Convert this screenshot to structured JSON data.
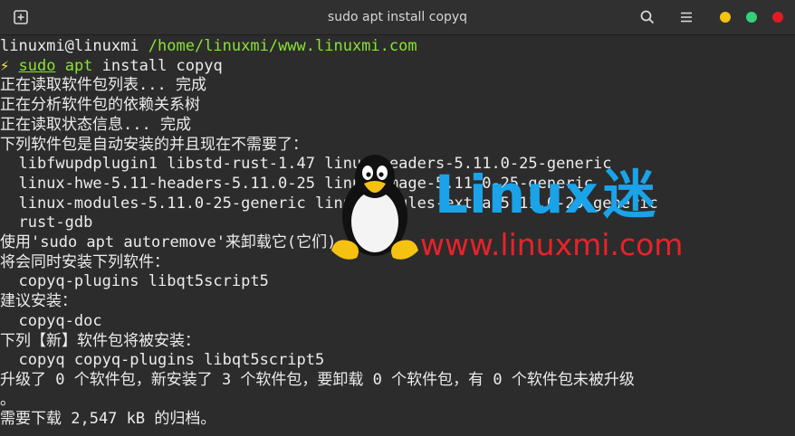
{
  "window": {
    "title": "sudo apt install copyq"
  },
  "prompt": {
    "user_host": "linuxmi@linuxmi",
    "path": "/home/linuxmi/www.linuxmi.com",
    "symbol": "⚡",
    "cmd_sudo": "sudo",
    "cmd_apt": "apt",
    "cmd_rest": " install copyq"
  },
  "output": [
    "正在读取软件包列表... 完成",
    "正在分析软件包的依赖关系树",
    "正在读取状态信息... 完成",
    "下列软件包是自动安装的并且现在不需要了：",
    "  libfwupdplugin1 libstd-rust-1.47 linux-headers-5.11.0-25-generic",
    "  linux-hwe-5.11-headers-5.11.0-25 linux-image-5.11.0-25-generic",
    "  linux-modules-5.11.0-25-generic linux-modules-extra-5.11.0-25-generic",
    "  rust-gdb",
    "使用'sudo apt autoremove'来卸载它(它们)。",
    "将会同时安装下列软件：",
    "  copyq-plugins libqt5script5",
    "建议安装：",
    "  copyq-doc",
    "下列【新】软件包将被安装：",
    "  copyq copyq-plugins libqt5script5",
    "升级了 0 个软件包，新安装了 3 个软件包，要卸载 0 个软件包，有 0 个软件包未被升级",
    "。",
    "需要下载 2,547 kB 的归档。"
  ],
  "watermark": {
    "brand": "Linux",
    "brand_suffix": "迷",
    "url": "www.linuxmi.com"
  },
  "colors": {
    "accent_green": "#8ae234",
    "accent_yellow": "#fce94f",
    "window_yellow": "#f5c211",
    "window_green": "#33d17a",
    "window_red": "#e01b24",
    "brand_blue": "#1aa3e8",
    "url_red": "#e8222a"
  },
  "icons": [
    "new-tab-icon",
    "search-icon",
    "hamburger-menu-icon",
    "tux-penguin-icon"
  ]
}
